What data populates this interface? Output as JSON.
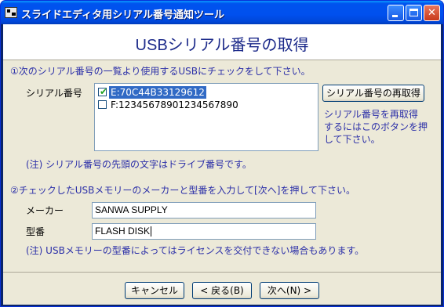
{
  "window": {
    "title": "スライドエディタ用シリアル番号通知ツール",
    "controls": {
      "minimize": "",
      "maximize": "",
      "close": "✕"
    }
  },
  "header": {
    "title": "USBシリアル番号の取得"
  },
  "step1": {
    "instruction": "①次のシリアル番号の一覧より使用するUSBにチェックをして下さい。",
    "label": "シリアル番号",
    "items": [
      {
        "label": "E:70C44B33129612",
        "checked": true,
        "check_mark": "✔"
      },
      {
        "label": "F:12345678901234567890",
        "checked": false,
        "check_mark": ""
      }
    ],
    "refresh_button": "シリアル番号の再取得",
    "refresh_help_lines": [
      "シリアル番号を再取得",
      "するにはこのボタンを押",
      "して下さい。"
    ],
    "note": "(注) シリアル番号の先頭の文字はドライブ番号です。"
  },
  "step2": {
    "instruction": "②チェックしたUSBメモリーのメーカーと型番を入力して[次へ]を押して下さい。",
    "maker_label": "メーカー",
    "maker_value": "SANWA SUPPLY",
    "model_label": "型番",
    "model_value": "FLASH DISK",
    "note": "(注) USBメモリーの型番によってはライセンスを交付できない場合もあります。"
  },
  "footer": {
    "cancel": "キャンセル",
    "back": "< 戻る(B)",
    "next": "次へ(N) >"
  }
}
